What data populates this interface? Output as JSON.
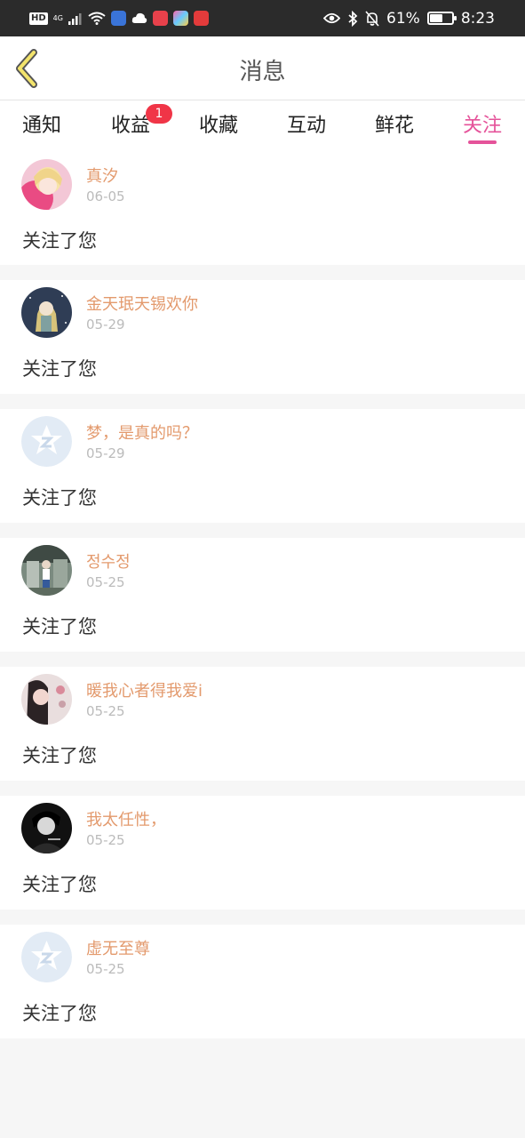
{
  "status_bar": {
    "left_badge": "HD",
    "network": "4G",
    "battery": "61%",
    "battery_level": 0.61,
    "time": "8:23"
  },
  "header": {
    "title": "消息",
    "back_icon": "chevron-left-icon"
  },
  "tabs": [
    {
      "label": "通知",
      "active": false
    },
    {
      "label": "收益",
      "active": false,
      "badge": "1"
    },
    {
      "label": "收藏",
      "active": false
    },
    {
      "label": "互动",
      "active": false
    },
    {
      "label": "鲜花",
      "active": false
    },
    {
      "label": "关注",
      "active": true
    }
  ],
  "colors": {
    "accent": "#e5539a",
    "username": "#e39a6d",
    "badge": "#f03547",
    "status_bar": "#2b2b2b"
  },
  "notifications": [
    {
      "name": "真汐",
      "date": "06-05",
      "message": "关注了您"
    },
    {
      "name": "金天珉天锡欢你",
      "date": "05-29",
      "message": "关注了您"
    },
    {
      "name": "梦，是真的吗？",
      "date": "05-29",
      "message": "关注了您"
    },
    {
      "name": "정수정",
      "date": "05-25",
      "message": "关注了您"
    },
    {
      "name": "暖我心者得我爱i",
      "date": "05-25",
      "message": "关注了您"
    },
    {
      "name": "我太任性，",
      "date": "05-25",
      "message": "关注了您"
    },
    {
      "name": "虚无至尊",
      "date": "05-25",
      "message": "关注了您"
    }
  ]
}
